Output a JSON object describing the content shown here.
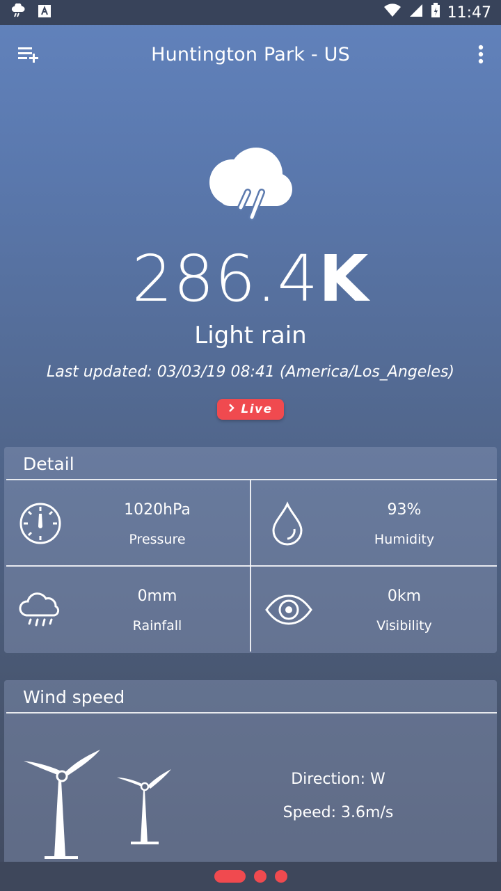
{
  "status_bar": {
    "time": "11:47"
  },
  "app_bar": {
    "title": "Huntington Park - US"
  },
  "current": {
    "temp_value": "286.4",
    "temp_unit": "K",
    "condition": "Light rain",
    "last_updated": "Last updated: 03/03/19 08:41 (America/Los_Angeles)",
    "live_label": "Live",
    "weather_icon": "rain-cloud-icon"
  },
  "detail": {
    "title": "Detail",
    "pressure": {
      "value": "1020hPa",
      "label": "Pressure",
      "icon": "gauge-icon"
    },
    "humidity": {
      "value": "93%",
      "label": "Humidity",
      "icon": "droplet-icon"
    },
    "rainfall": {
      "value": "0mm",
      "label": "Rainfall",
      "icon": "rain-cloud-icon"
    },
    "visibility": {
      "value": "0km",
      "label": "Visibility",
      "icon": "eye-icon"
    }
  },
  "wind": {
    "title": "Wind speed",
    "direction": "Direction: W",
    "speed": "Speed: 3.6m/s",
    "icon": "wind-turbine-icon"
  },
  "pager": {
    "pages": 3,
    "active_page": 1
  },
  "colors": {
    "accent": "#f04a4f",
    "status_bar": "#38435a"
  }
}
